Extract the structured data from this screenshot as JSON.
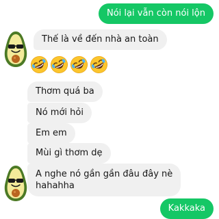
{
  "conversation": {
    "messages": [
      {
        "sender": "me",
        "text": "Nói lại vẫn còn nói lộn"
      },
      {
        "sender": "them",
        "text": "Thế là về đến nhà an toàn"
      },
      {
        "sender": "them",
        "emoji": [
          "rolling-laughing",
          "rolling-laughing",
          "rolling-laughing",
          "rolling-laughing"
        ]
      },
      {
        "sender": "them",
        "text": "Thơm quá ba"
      },
      {
        "sender": "them",
        "text": "Nó mới hỏi"
      },
      {
        "sender": "them",
        "text": "Em em"
      },
      {
        "sender": "them",
        "text": "Mùi gì thơm dẹ"
      },
      {
        "sender": "them",
        "lines": [
          "A nghe nó gần gần đâu đây nè",
          "hahahha"
        ]
      },
      {
        "sender": "me",
        "text": "Kakkaka"
      }
    ]
  },
  "icons": {
    "contact_avatar": "avocado-sunglasses-avatar",
    "reaction": "rolling-laughing-emoji"
  },
  "colors": {
    "sent_bubble": "#15c765",
    "received_bubble": "#f0f0f0",
    "background": "#ffffff"
  }
}
